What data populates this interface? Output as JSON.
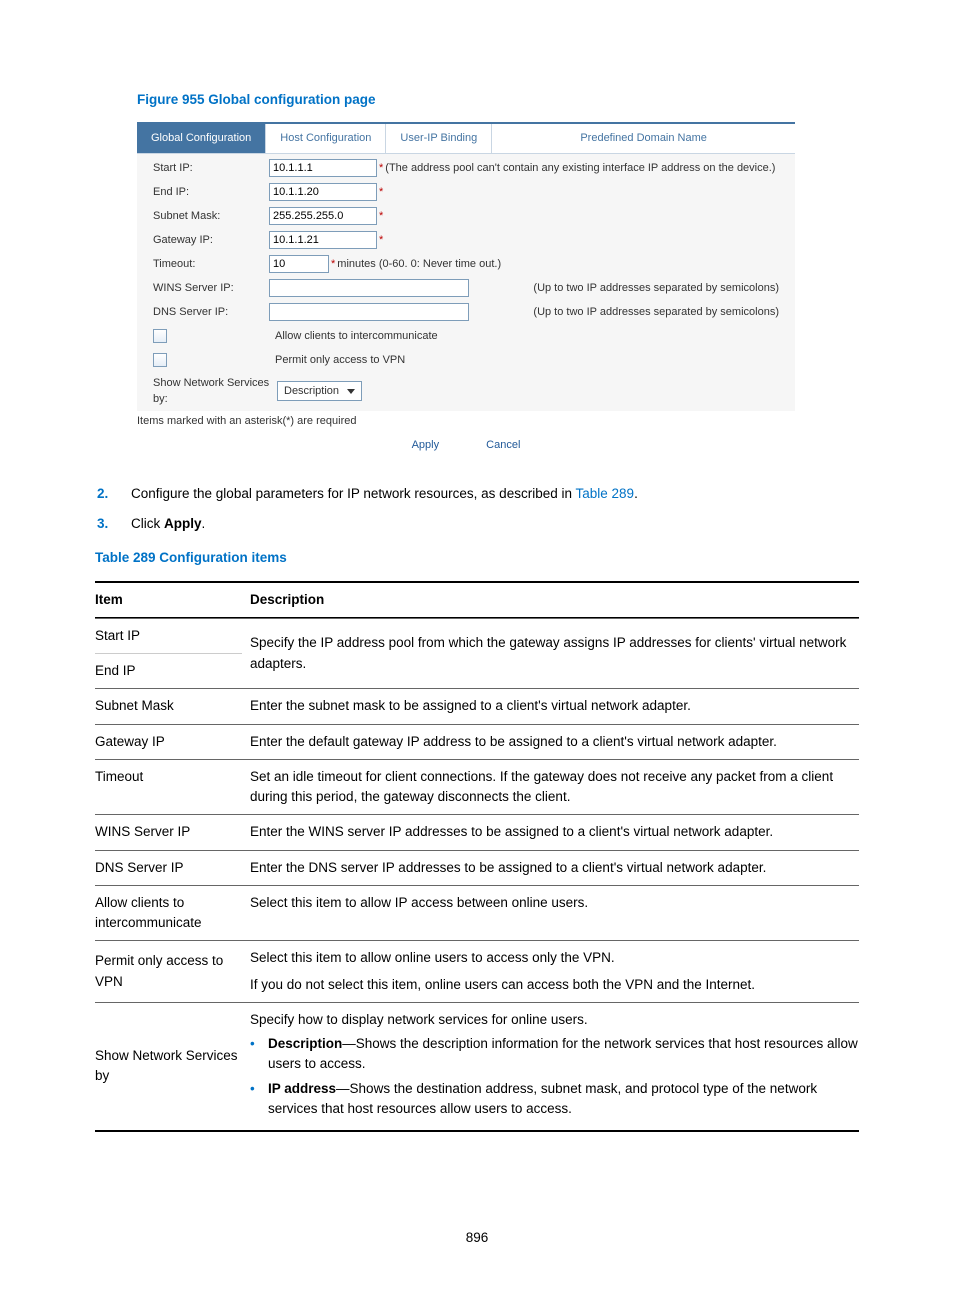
{
  "figure_title": "Figure 955 Global configuration page",
  "tabs": [
    "Global Configuration",
    "Host Configuration",
    "User-IP Binding",
    "Predefined Domain Name"
  ],
  "form": {
    "start_ip": {
      "label": "Start IP:",
      "value": "10.1.1.1",
      "hint": "(The address pool can't contain any existing interface IP address on the device.)"
    },
    "end_ip": {
      "label": "End IP:",
      "value": "10.1.1.20"
    },
    "subnet": {
      "label": "Subnet Mask:",
      "value": "255.255.255.0"
    },
    "gateway": {
      "label": "Gateway IP:",
      "value": "10.1.1.21"
    },
    "timeout": {
      "label": "Timeout:",
      "value": "10",
      "hint": "minutes (0-60. 0: Never time out.)"
    },
    "wins": {
      "label": "WINS Server IP:",
      "hint": "(Up to two IP addresses separated by semicolons)"
    },
    "dns": {
      "label": "DNS Server IP:",
      "hint": "(Up to two IP addresses separated by semicolons)"
    },
    "allow": "Allow clients to intercommunicate",
    "permit": "Permit only access to VPN",
    "show_label": "Show Network Services by:",
    "show_value": "Description",
    "required_note": "Items marked with an asterisk(*) are required",
    "apply": "Apply",
    "cancel": "Cancel"
  },
  "steps": [
    {
      "n": "2.",
      "pre": "Configure the global parameters for IP network resources, as described in ",
      "link": "Table 289",
      "post": "."
    },
    {
      "n": "3.",
      "pre": "Click ",
      "bold": "Apply",
      "post": "."
    }
  ],
  "table_title": "Table 289 Configuration items",
  "table_header": {
    "item": "Item",
    "desc": "Description"
  },
  "table": {
    "start_ip": "Start IP",
    "end_ip": "End IP",
    "pool_desc": "Specify the IP address pool from which the gateway assigns IP addresses for clients' virtual network adapters.",
    "subnet": {
      "item": "Subnet Mask",
      "desc": "Enter the subnet mask to be assigned to a client's virtual network adapter."
    },
    "gateway": {
      "item": "Gateway IP",
      "desc": "Enter the default gateway IP address to be assigned to a client's virtual network adapter."
    },
    "timeout": {
      "item": "Timeout",
      "desc": "Set an idle timeout for client connections. If the gateway does not receive any packet from a client during this period, the gateway disconnects the client."
    },
    "wins": {
      "item": "WINS Server IP",
      "desc": "Enter the WINS server IP addresses to be assigned to a client's virtual network adapter."
    },
    "dns": {
      "item": "DNS Server IP",
      "desc": "Enter the DNS server IP addresses to be assigned to a client's virtual network adapter."
    },
    "allow": {
      "item": "Allow clients to intercommunicate",
      "desc": "Select this item to allow IP access between online users."
    },
    "permit": {
      "item": "Permit only access to VPN",
      "line1": "Select this item to allow online users to access only the VPN.",
      "line2": "If you do not select this item, online users can access both the VPN and the Internet."
    },
    "show": {
      "item": "Show Network Services by",
      "intro": "Specify how to display network services for online users.",
      "b1_label": "Description",
      "b1_text": "—Shows the description information for the network services that host resources allow users to access.",
      "b2_label": "IP address",
      "b2_text": "—Shows the destination address, subnet mask, and protocol type of the network services that host resources allow users to access."
    }
  },
  "page_number": "896"
}
